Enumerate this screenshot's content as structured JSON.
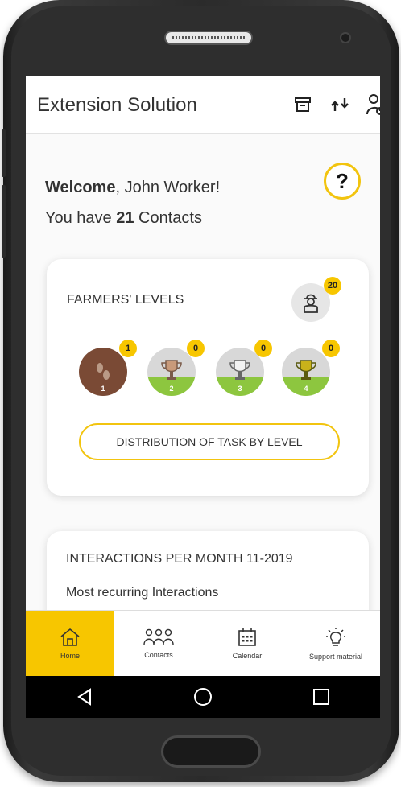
{
  "appbar": {
    "title": "Extension Solution",
    "icons": [
      "archive-icon",
      "sync-icon",
      "user-settings-icon"
    ]
  },
  "welcome": {
    "greeting_bold": "Welcome",
    "greeting_rest": ", John Worker!",
    "contacts_prefix": "You have ",
    "contacts_count": "21",
    "contacts_suffix": " Contacts",
    "help_symbol": "?"
  },
  "farmers_levels": {
    "title": "FARMERS' LEVELS",
    "total_badge": "20",
    "levels": [
      {
        "level": "1",
        "count": "1",
        "icon": "footprints-icon"
      },
      {
        "level": "2",
        "count": "0",
        "icon": "bronze-trophy-icon"
      },
      {
        "level": "3",
        "count": "0",
        "icon": "silver-trophy-icon"
      },
      {
        "level": "4",
        "count": "0",
        "icon": "gold-trophy-icon"
      }
    ],
    "distribution_button": "DISTRIBUTION OF TASK BY LEVEL"
  },
  "interactions": {
    "title": "INTERACTIONS PER MONTH 11-2019",
    "subtitle": "Most recurring Interactions"
  },
  "bottom_nav": {
    "items": [
      {
        "label": "Home",
        "icon": "home-icon",
        "active": true
      },
      {
        "label": "Contacts",
        "icon": "contacts-icon",
        "active": false
      },
      {
        "label": "Calendar",
        "icon": "calendar-icon",
        "active": false
      },
      {
        "label": "Support material",
        "icon": "lightbulb-icon",
        "active": false
      }
    ]
  },
  "colors": {
    "accent": "#f7c600",
    "level1": "#7a4a35",
    "green": "#8dc63f"
  }
}
